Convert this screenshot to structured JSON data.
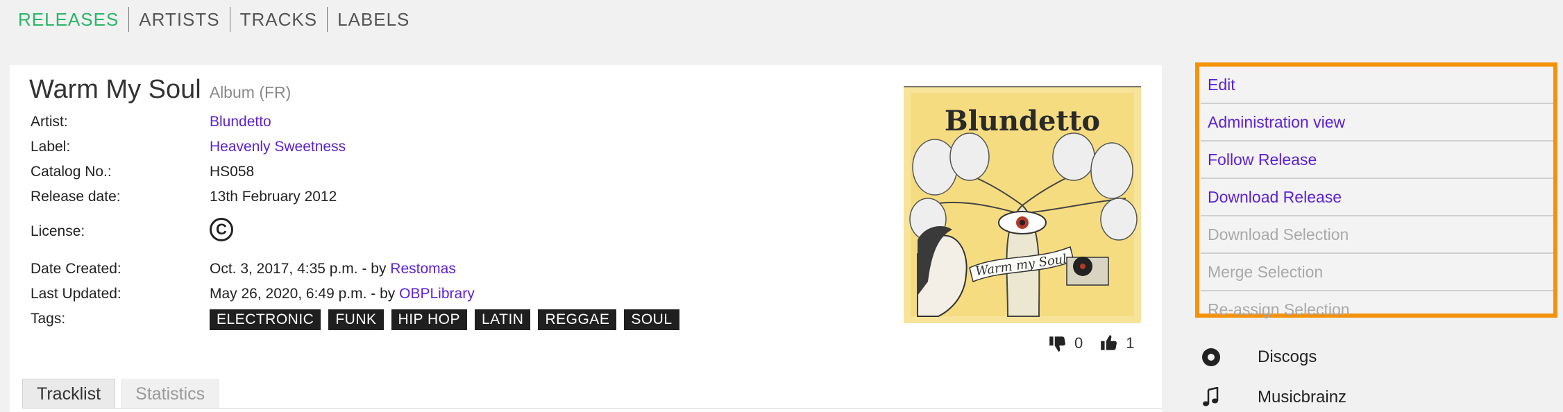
{
  "nav": {
    "items": [
      {
        "label": "RELEASES",
        "active": true
      },
      {
        "label": "ARTISTS",
        "active": false
      },
      {
        "label": "TRACKS",
        "active": false
      },
      {
        "label": "LABELS",
        "active": false
      }
    ]
  },
  "release": {
    "title": "Warm My Soul",
    "type": "Album (FR)",
    "artist_label": "Artist:",
    "artist": "Blundetto",
    "label_label": "Label:",
    "label": "Heavenly Sweetness",
    "catalog_label": "Catalog No.:",
    "catalog": "HS058",
    "release_date_label": "Release date:",
    "release_date": "13th February 2012",
    "license_label": "License:",
    "license_icon": "copyright-icon",
    "created_label": "Date Created:",
    "created": "Oct. 3, 2017, 4:35 p.m. - by ",
    "created_by": "Restomas",
    "updated_label": "Last Updated:",
    "updated": "May 26, 2020, 6:49 p.m. - by ",
    "updated_by": "OBPLibrary",
    "tags_label": "Tags:",
    "tags": [
      "ELECTRONIC",
      "FUNK",
      "HIP HOP",
      "LATIN",
      "REGGAE",
      "SOUL"
    ]
  },
  "cover": {
    "text": "Blundetto",
    "script_text": "Warm my Soul"
  },
  "votes": {
    "down": "0",
    "up": "1"
  },
  "tabs": [
    {
      "label": "Tracklist",
      "active": true
    },
    {
      "label": "Statistics",
      "active": false
    }
  ],
  "actions": [
    {
      "label": "Edit",
      "enabled": true
    },
    {
      "label": "Administration view",
      "enabled": true
    },
    {
      "label": "Follow Release",
      "enabled": true
    },
    {
      "label": "Download Release",
      "enabled": true
    },
    {
      "label": "Download Selection",
      "enabled": false
    },
    {
      "label": "Merge Selection",
      "enabled": false
    },
    {
      "label": "Re-assign Selection",
      "enabled": false
    }
  ],
  "external_links": [
    {
      "label": "Discogs",
      "icon": "discogs-icon"
    },
    {
      "label": "Musicbrainz",
      "icon": "music-note-icon"
    }
  ],
  "colors": {
    "nav_active": "#2bb567",
    "link": "#5a1fd6",
    "highlight_border": "#f4920c",
    "tag_bg": "#1f1f1f"
  }
}
